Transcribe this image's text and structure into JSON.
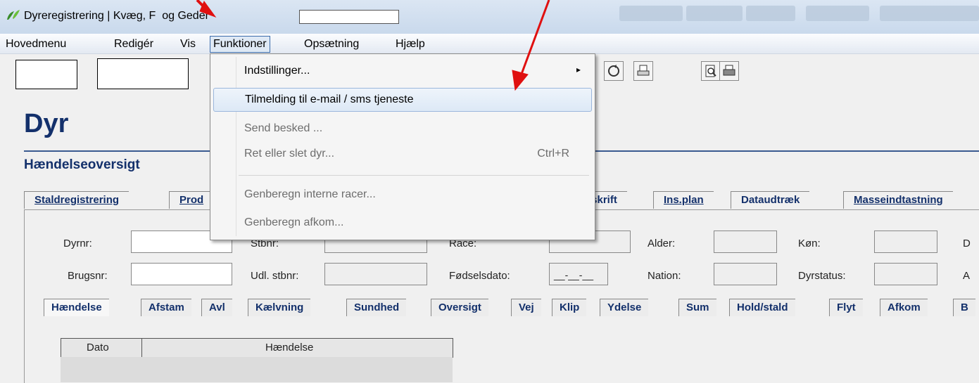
{
  "window": {
    "title": "Dyreregistrering | Kvæg, F  og Geder"
  },
  "menubar": {
    "items": [
      "Hovedmenu",
      "Redigér",
      "Vis",
      "Funktioner",
      "Opsætning",
      "Hjælp"
    ]
  },
  "dropdown": {
    "items": [
      {
        "label": "Indstillinger...",
        "shortcut": "",
        "submenu_arrow": "▸",
        "enabled": true
      },
      {
        "label": "Tilmelding til e-mail / sms tjeneste",
        "shortcut": "",
        "enabled": true,
        "highlighted": true
      },
      {
        "label": "Send besked ...",
        "shortcut": "",
        "enabled": false
      },
      {
        "label": "Ret eller slet dyr...",
        "shortcut": "Ctrl+R",
        "enabled": false
      },
      {
        "label": "Genberegn interne racer...",
        "shortcut": "",
        "enabled": false
      },
      {
        "label": "Genberegn afkom...",
        "shortcut": "",
        "enabled": false
      }
    ]
  },
  "page": {
    "heading": "Dyr",
    "subheading": "Hændelseoversigt"
  },
  "main_tabs": [
    "Staldregistrering",
    "Prod",
    "dskrift",
    "Ins.plan",
    "Dataudtræk",
    "Masseindtastning"
  ],
  "fields": {
    "dyrnr": "Dyrnr:",
    "brugsnr": "Brugsnr:",
    "stbnr": "Stbnr:",
    "udl_stbnr": "Udl. stbnr:",
    "race": "Race:",
    "foedselsdato": "Fødselsdato:",
    "foedselsdato_value": "__-__-__",
    "alder": "Alder:",
    "nation": "Nation:",
    "koen": "Køn:",
    "dyrstatus": "Dyrstatus:",
    "cut_d": "D",
    "cut_a": "A"
  },
  "sub_tabs": [
    "Hændelse",
    "Afstam",
    "Avl",
    "Kælvning",
    "Sundhed",
    "Oversigt",
    "Vej",
    "Klip",
    "Ydelse",
    "Sum",
    "Hold/stald",
    "Flyt",
    "Afkom",
    "B"
  ],
  "grid": {
    "columns": [
      "Dato",
      "Hændelse"
    ]
  },
  "colors": {
    "accent": "#13306b",
    "annotation_arrow": "#e01010"
  },
  "icons": {
    "app": "leaf-icon",
    "refresh": "refresh-icon",
    "print_preview": "print-preview-icon",
    "print": "print-icon",
    "print2": "printer-icon"
  }
}
